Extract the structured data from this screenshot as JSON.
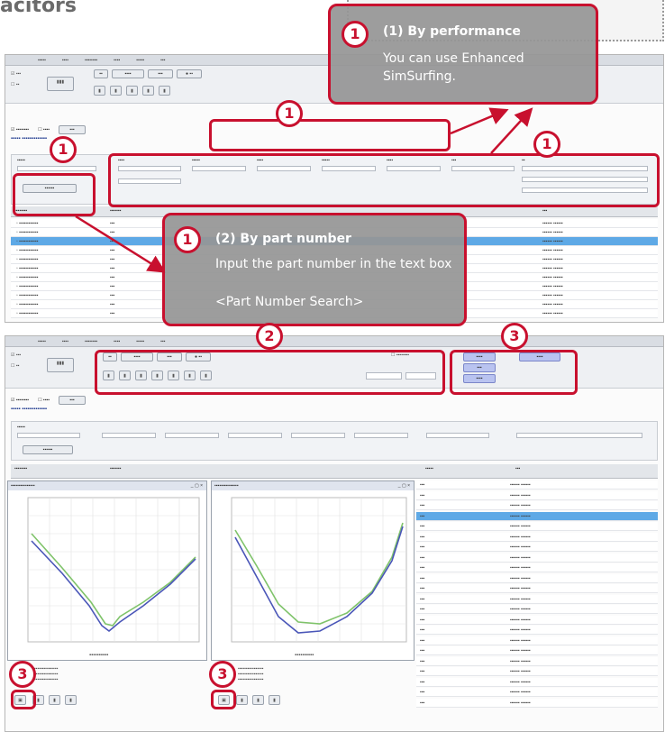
{
  "page": {
    "heading": "acitors"
  },
  "callouts": {
    "performance": {
      "number": "1",
      "title": "(1) By performance",
      "text": "You can use Enhanced SimSurfing."
    },
    "part_number": {
      "number": "1",
      "title": "(2) By part number",
      "line1": "Input the part number in the text box",
      "line2": "<Part Number Search>"
    }
  },
  "badges": {
    "b1": "1",
    "b2": "2",
    "b3": "3"
  },
  "colors": {
    "accent_red": "#c8102e",
    "callout_gray": "#969696",
    "row_selected": "#5ea9e6",
    "curve_blue": "#4a56b8",
    "curve_green": "#7fc36a"
  }
}
